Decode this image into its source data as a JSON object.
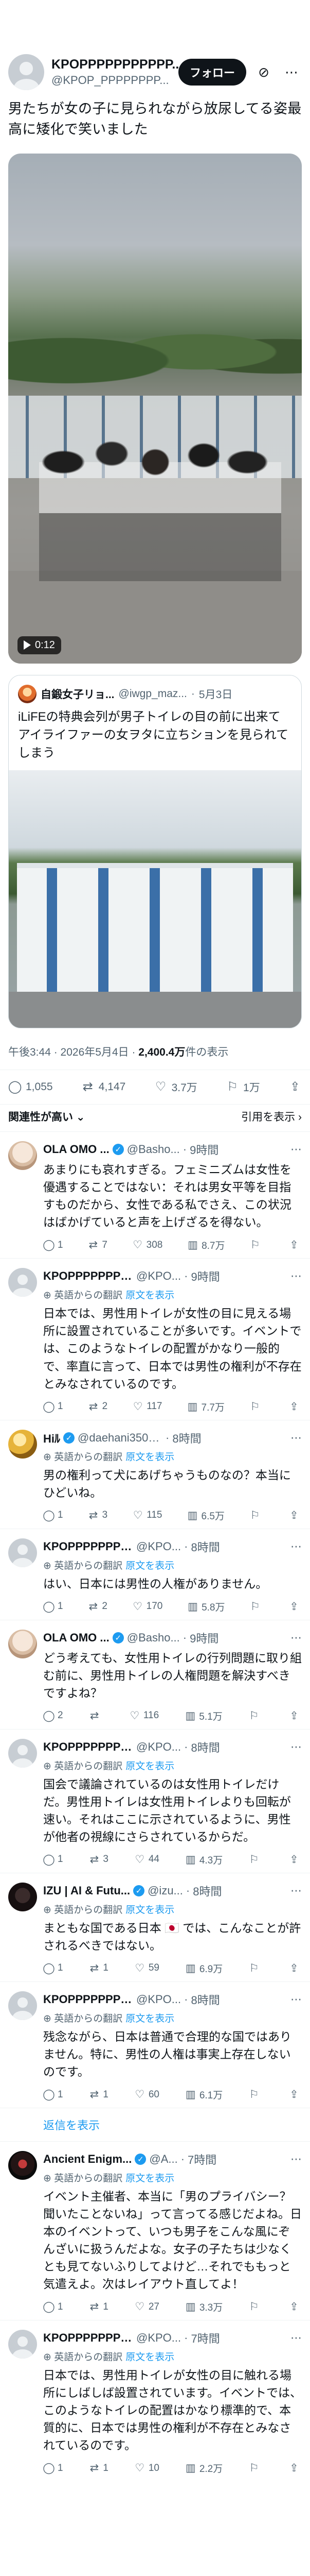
{
  "post": {
    "author_name": "KPOPPPPPPPPPPP...",
    "author_handle": "@KPOP_PPPPPPPP...",
    "follow_label": "フォロー",
    "text": "男たちが女の子に見られながら放尿してる姿最高に矮化で笑いました",
    "video_duration": "0:12",
    "quote": {
      "name": "自鍛女子リョ...",
      "handle": "@iwgp_maz...",
      "date": "5月3日",
      "text": "iLiFEの特典会列が男子トイレの目の前に出来てアイライファーの女ヲタに立ちションを見られてしまう"
    },
    "time": "午後3:44",
    "date": "2026年5月4日",
    "views_count": "2,400.4万",
    "views_label": "件の表示",
    "stats": {
      "replies": "1,055",
      "reposts": "4,147",
      "likes": "3.7万",
      "bookmarks": "1万"
    }
  },
  "sort": {
    "left": "関連性が高い",
    "right": "引用を表示"
  },
  "translation_label": "英語からの翻訳",
  "show_original_label": "原文を表示",
  "replies": [
    {
      "avatar": "cat",
      "name": "OLA OMO ...",
      "verified": true,
      "handle": "@Basho...",
      "time": "9時間",
      "translated": false,
      "text": "あまりにも哀れすぎる。フェミニズムは女性を優遇することではない：それは男女平等を目指すものだから、女性である私でさえ、この状況はばかげていると声を上げざるを得ない。",
      "stats": [
        "1",
        "7",
        "308",
        "8.7万",
        ""
      ]
    },
    {
      "avatar": "grey",
      "name": "KPOPPPPPPPPPPP...",
      "verified": false,
      "handle": "@KPO...",
      "time": "9時間",
      "translated": true,
      "text": "日本では、男性用トイレが女性の目に見える場所に設置されていることが多いです。イベントでは、このようなトイレの配置がかなり一般的で、率直に言って、日本では男性の権利が不存在とみなされているのです。",
      "stats": [
        "1",
        "2",
        "117",
        "7.7万",
        ""
      ]
    },
    {
      "avatar": "gold",
      "name": "Hiﾙ",
      "verified": true,
      "handle": "@daehani350331",
      "time": "8時間",
      "translated": true,
      "text": "男の権利って犬にあげちゃうものなの？本当にひどいね。",
      "stats": [
        "1",
        "3",
        "115",
        "6.5万",
        ""
      ]
    },
    {
      "avatar": "grey",
      "name": "KPOPPPPPPPPPPP...",
      "verified": false,
      "handle": "@KPO...",
      "time": "8時間",
      "translated": true,
      "text": "はい、日本には男性の人権がありません。",
      "stats": [
        "1",
        "2",
        "170",
        "5.8万",
        ""
      ]
    },
    {
      "avatar": "cat",
      "name": "OLA OMO ...",
      "verified": true,
      "handle": "@Basho...",
      "time": "9時間",
      "translated": false,
      "text": "どう考えても、女性用トイレの行列問題に取り組む前に、男性用トイレの人権問題を解決すべきですよね？",
      "stats": [
        "2",
        "",
        "116",
        "5.1万",
        ""
      ]
    },
    {
      "avatar": "grey",
      "name": "KPOPPPPPPPPPPP...",
      "verified": false,
      "handle": "@KPO...",
      "time": "8時間",
      "translated": true,
      "text": "国会で議論されているのは女性用トイレだけだ。男性用トイレは女性用トイレよりも回転が速い。それはここに示されているように、男性が他者の視線にさらされているからだ。",
      "stats": [
        "1",
        "3",
        "44",
        "4.3万",
        ""
      ]
    },
    {
      "avatar": "dark",
      "name": "IZU | AI & Futu...",
      "verified": true,
      "handle": "@izu...",
      "time": "8時間",
      "translated": true,
      "text": "まともな国である日本 🇯🇵 では、こんなことが許されるべきではない。",
      "stats": [
        "1",
        "1",
        "59",
        "6.9万",
        ""
      ]
    },
    {
      "avatar": "grey",
      "name": "KPOPPPPPPPPPPP...",
      "verified": false,
      "handle": "@KPO...",
      "time": "8時間",
      "translated": true,
      "text": "残念ながら、日本は普通で合理的な国ではありません。特に、男性の人権は事実上存在しないのです。",
      "stats": [
        "1",
        "1",
        "60",
        "6.1万",
        ""
      ]
    },
    {
      "avatar": "dark2",
      "name": "Ancient Enigm...",
      "verified": true,
      "handle": "@A...",
      "time": "7時間",
      "translated": true,
      "text": "イベント主催者、本当に「男のプライバシー？聞いたことないね」って言ってる感じだよね。日本のイベントって、いつも男子をこんな風にぞんざいに扱うんだよな。女子の子たちは少なくとも見てないふりしてよけど…それでももっと気遣えよ。次はレイアウト直してよ！",
      "stats": [
        "1",
        "1",
        "27",
        "3.3万",
        ""
      ]
    },
    {
      "avatar": "grey",
      "name": "KPOPPPPPPPPPPP...",
      "verified": false,
      "handle": "@KPO...",
      "time": "7時間",
      "translated": true,
      "text": "日本では、男性用トイレが女性の目に触れる場所にしばしば設置されています。イベントでは、このようなトイレの配置はかなり標準的で、本質的に、日本では男性の権利が不存在とみなされているのです。",
      "stats": [
        "1",
        "1",
        "10",
        "2.2万",
        ""
      ]
    }
  ],
  "show_replies_label": "返信を表示"
}
